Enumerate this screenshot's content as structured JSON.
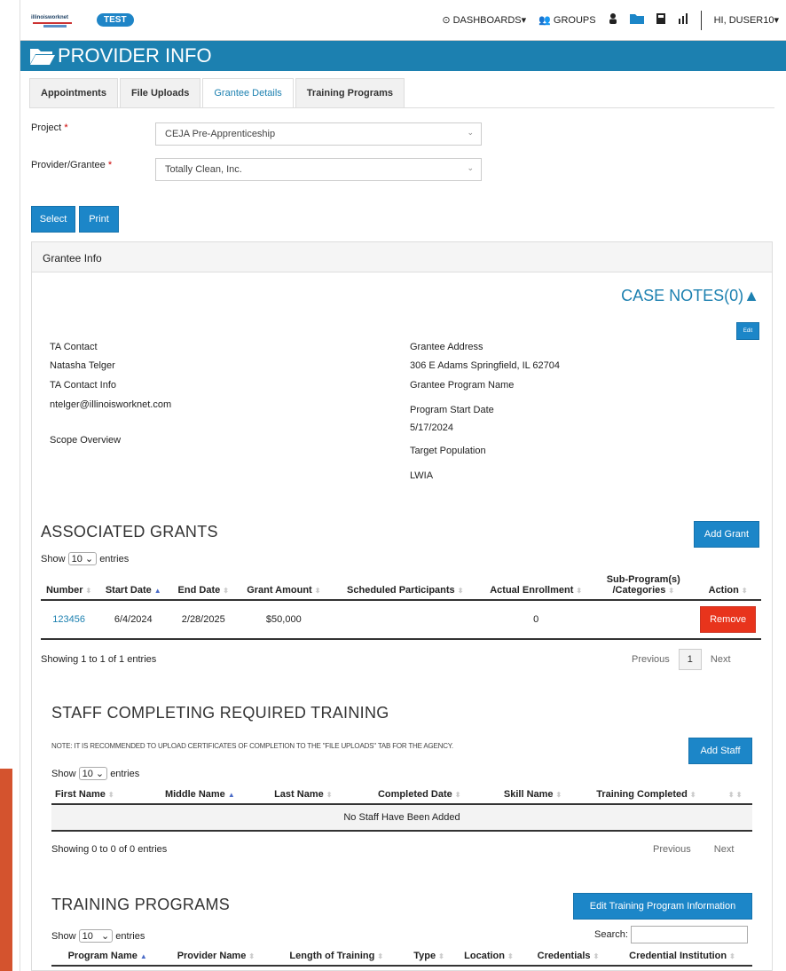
{
  "topbar": {
    "badge": "TEST",
    "nav": {
      "dashboards": "DASHBOARDS",
      "groups": "GROUPS",
      "user": "HI, DUSER10"
    }
  },
  "header": {
    "title": "PROVIDER INFO"
  },
  "tabs": [
    {
      "label": "Appointments"
    },
    {
      "label": "File Uploads"
    },
    {
      "label": "Grantee Details"
    },
    {
      "label": "Training Programs"
    }
  ],
  "form": {
    "project_label": "Project",
    "project_value": "CEJA Pre-Apprenticeship",
    "provider_label": "Provider/Grantee",
    "provider_value": "Totally Clean, Inc.",
    "select_button": "Select",
    "print_button": "Print"
  },
  "grantee_info": {
    "panel_title": "Grantee Info",
    "case_notes": "CASE NOTES(0)",
    "edit_button": "Edit",
    "ta_contact_label": "TA Contact",
    "ta_contact_value": "Natasha Telger",
    "ta_contact_info_label": "TA Contact Info",
    "ta_contact_info_value": "ntelger@illinoisworknet.com",
    "scope_overview_label": "Scope Overview",
    "grantee_address_label": "Grantee Address",
    "grantee_address_value": "306 E Adams Springfield, IL 62704",
    "program_name_label": "Grantee Program Name",
    "program_start_label": "Program Start Date",
    "program_start_value": "5/17/2024",
    "target_population_label": "Target Population",
    "lwia_label": "LWIA"
  },
  "associated_grants": {
    "title": "ASSOCIATED GRANTS",
    "add_button": "Add Grant",
    "show_label": "Show",
    "show_value": "10",
    "entries_label": "entries",
    "columns": [
      "Number",
      "Start Date",
      "End Date",
      "Grant Amount",
      "Scheduled Participants",
      "Actual Enrollment",
      "Sub-Program(s) /Categories",
      "Action"
    ],
    "rows": [
      {
        "number": "123456",
        "start": "6/4/2024",
        "end": "2/28/2025",
        "amount": "$50,000",
        "scheduled": "",
        "enrollment": "0",
        "sub": "",
        "action": "Remove"
      }
    ],
    "info": "Showing 1 to 1 of 1 entries",
    "prev": "Previous",
    "page": "1",
    "next": "Next"
  },
  "staff_training": {
    "title": "STAFF COMPLETING REQUIRED TRAINING",
    "note": "NOTE: IT IS RECOMMENDED TO UPLOAD CERTIFICATES OF COMPLETION TO THE \"FILE UPLOADS\" TAB FOR THE AGENCY.",
    "add_button": "Add Staff",
    "show_label": "Show",
    "show_value": "10",
    "entries_label": "entries",
    "columns": [
      "First Name",
      "Middle Name",
      "Last Name",
      "Completed Date",
      "Skill Name",
      "Training Completed"
    ],
    "empty": "No Staff Have Been Added",
    "info": "Showing 0 to 0 of 0 entries",
    "prev": "Previous",
    "next": "Next"
  },
  "training_programs": {
    "title": "TRAINING PROGRAMS",
    "edit_button": "Edit Training Program Information",
    "show_label": "Show",
    "show_value": "10",
    "entries_label": "entries",
    "search_label": "Search:",
    "columns": [
      "Program Name",
      "Provider Name",
      "Length of Training",
      "Type",
      "Location",
      "Credentials",
      "Credential Institution"
    ]
  },
  "colors": {
    "brand": "#1c80b0",
    "button": "#1c86c8",
    "danger": "#e8341c",
    "accent_side": "#d4532e"
  }
}
